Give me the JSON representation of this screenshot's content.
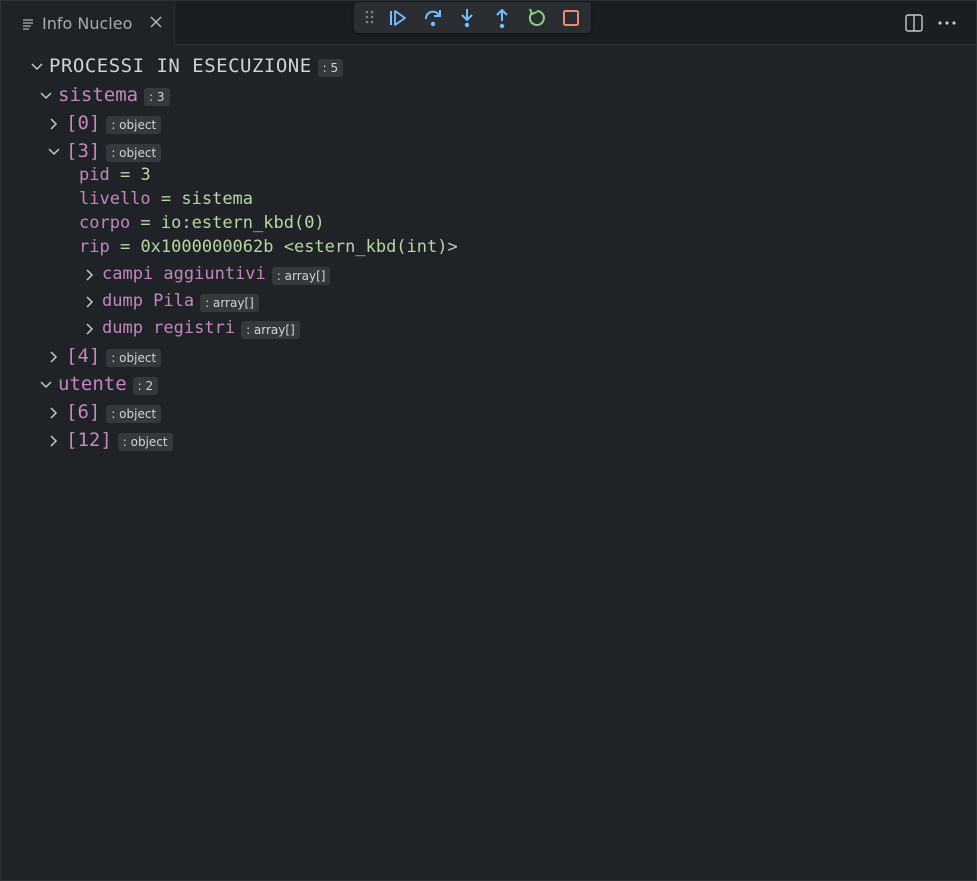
{
  "tab": {
    "title": "Info Nucleo"
  },
  "colors": {
    "background": "#1f2226",
    "key": "#c586c0",
    "value": "#b8d7a3",
    "debug_blue": "#75beff",
    "debug_green": "#89d185",
    "debug_red": "#f48771"
  },
  "debug_toolbar": {
    "icons": [
      "grip-icon",
      "continue-icon",
      "step-over-icon",
      "step-into-icon",
      "step-out-icon",
      "restart-icon",
      "stop-icon"
    ]
  },
  "header_actions": {
    "icons": [
      "split-editor-icon",
      "more-actions-icon"
    ]
  },
  "tree": {
    "root": {
      "label": "PROCESSI IN ESECUZIONE",
      "badge": ": 5"
    },
    "sistema": {
      "label": "sistema",
      "badge": ": 3"
    },
    "item0": {
      "label": "[0]",
      "badge": ": object"
    },
    "item3": {
      "label": "[3]",
      "badge": ": object",
      "pid": {
        "key": "pid",
        "eq": " = ",
        "value": "3"
      },
      "livello": {
        "key": "livello",
        "eq": " = ",
        "value": "sistema"
      },
      "corpo": {
        "key": "corpo",
        "eq": " = ",
        "value": "io:estern_kbd(0)"
      },
      "rip": {
        "key": "rip",
        "eq": " = ",
        "value": "0x1000000062b <estern_kbd(int)>"
      },
      "campi": {
        "label": "campi aggiuntivi",
        "badge": ": array[]"
      },
      "pila": {
        "label": "dump Pila",
        "badge": ": array[]"
      },
      "registri": {
        "label": "dump registri",
        "badge": ": array[]"
      }
    },
    "item4": {
      "label": "[4]",
      "badge": ": object"
    },
    "utente": {
      "label": "utente",
      "badge": ": 2"
    },
    "item6": {
      "label": "[6]",
      "badge": ": object"
    },
    "item12": {
      "label": "[12]",
      "badge": ": object"
    }
  }
}
